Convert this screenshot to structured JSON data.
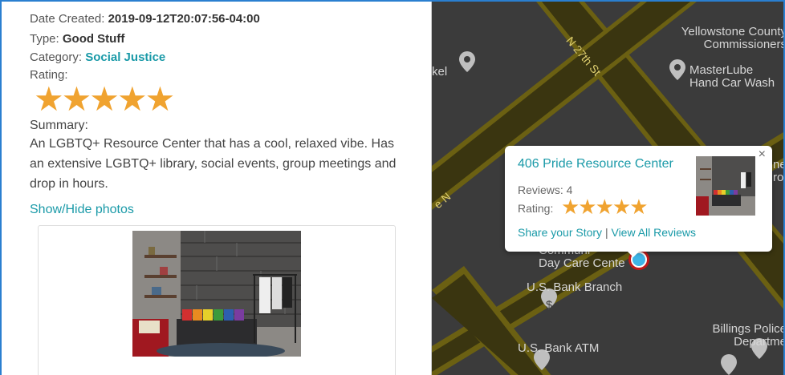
{
  "details": {
    "date_label": "Date Created: ",
    "date_value": "2019-09-12T20:07:56-04:00",
    "type_label": "Type: ",
    "type_value": "Good Stuff",
    "category_label": "Category: ",
    "category_value": "Social Justice",
    "rating_label": "Rating:",
    "rating_stars": "★★★★★",
    "rating_value": 5,
    "summary_label": "Summary:",
    "summary_text": "An LGBTQ+ Resource Center that has a cool, relaxed vibe. Has an extensive LGBTQ+ library, social events, group meetings and drop in hours.",
    "toggle_photos": "Show/Hide photos"
  },
  "map": {
    "street_1": "N 27th St",
    "street_2": "e N",
    "places": {
      "p1": "kel",
      "p2_line1": "Yellowstone County",
      "p2_line2": "Commissioners",
      "p3_line1": "MasterLube",
      "p3_line2": "Hand Car Wash",
      "p4_line1": "Communi",
      "p4_line2": "Day Care Cente",
      "p5": "U.S. Bank Branch",
      "p6": "U.S. Bank ATM",
      "p7_line1": "Billings Police",
      "p7_line2": "Departme",
      "p8_a": "ne",
      "p8_b": "ro"
    },
    "colors": {
      "background": "#3b3b3b",
      "road": "#3a3510",
      "road_edge": "#6b6012",
      "label": "#d6d6d6"
    }
  },
  "popup": {
    "title": "406 Pride Resource Center",
    "close": "×",
    "reviews": "Reviews: 4",
    "rating_label": "Rating:",
    "rating_stars": "★★★★★",
    "rating_value": 5,
    "link_share": "Share your Story",
    "separator": "|",
    "link_reviews": "View All Reviews"
  },
  "colors": {
    "accent": "#1a9aa8",
    "star": "#f0a330",
    "frame": "#2a7fd0"
  }
}
